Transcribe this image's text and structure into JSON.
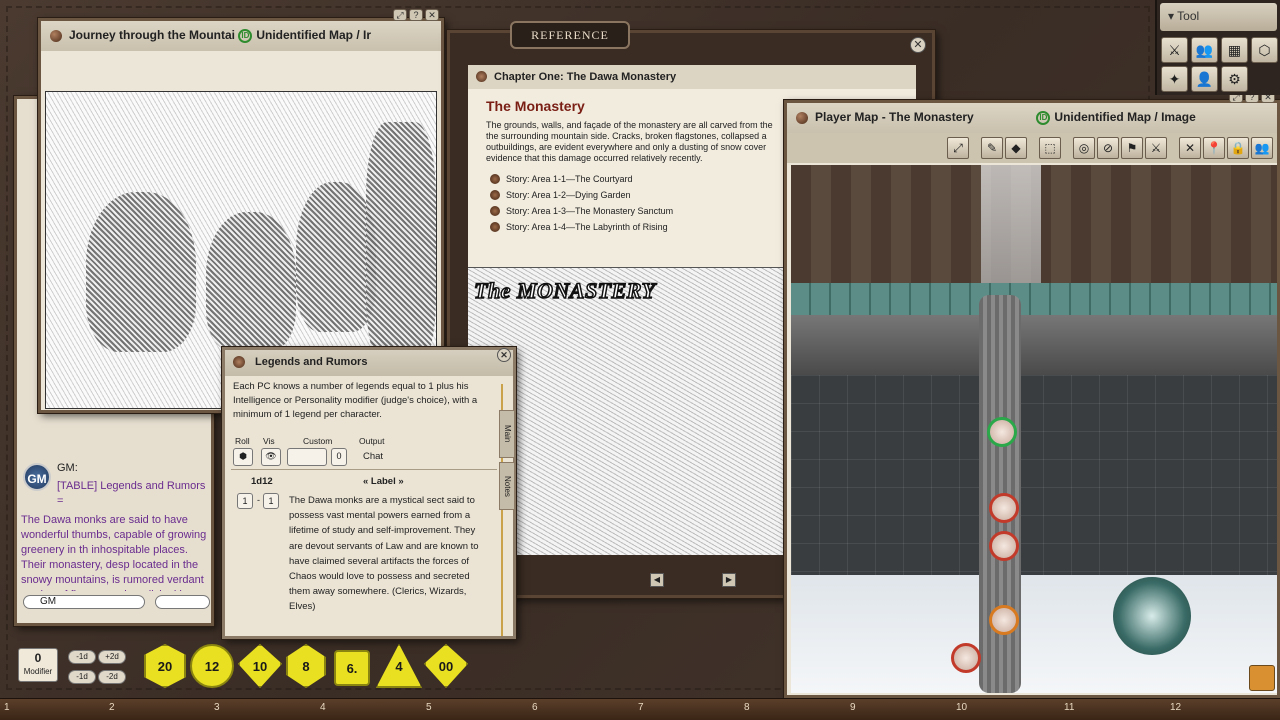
{
  "tool_panel": {
    "title": "Tool",
    "icons": [
      "swords-icon",
      "party-icon",
      "calendar-icon",
      "dice-icon",
      "effects-icon",
      "people-icon",
      "gear-icon"
    ]
  },
  "journey_window": {
    "title": "Journey through the Mountai",
    "id_badge": "ID",
    "subtitle": "Unidentified Map / Ir"
  },
  "chat": {
    "speaker": "GM:",
    "avatar": "GM",
    "table_line": "[TABLE] Legends and Rumors =",
    "message": "The Dawa monks are said to have wonderful thumbs, capable of growing greenery in th inhospitable places. Their monastery, desp located in the snowy mountains, is rumored verdant garden of flowers and medicinal h Warriors, Elves, Clerics)",
    "dropdown_value": "GM"
  },
  "reference": {
    "tab_label": "REFERENCE",
    "header": "Chapter One: The Dawa Monastery",
    "title": "The Monastery",
    "body": "The grounds, walls, and façade of the monastery are all carved from the the surrounding mountain side. Cracks, broken flagstones, collapsed a outbuildings, are evident everywhere and only a dusting of snow cover evidence that this damage occurred relatively recently.",
    "story_links": [
      "Story: Area 1-1—The Courtyard",
      "Story: Area 1-2—Dying Garden",
      "Story: Area 1-3—The Monastery Sanctum",
      "Story: Area 1-4—The Labyrinth of Rising"
    ],
    "art_title": "The MONASTERY"
  },
  "player_map": {
    "title": "Player Map - The Monastery",
    "id_badge": "ID",
    "subtitle": "Unidentified Map / Image"
  },
  "legends": {
    "title": "Legends and Rumors",
    "description": "Each PC knows a number of legends equal to 1 plus his Intelligence or Personality modifier (judge's choice), with a minimum of 1 legend per character.",
    "col_roll": "Roll",
    "col_vis": "Vis",
    "col_custom": "Custom",
    "col_output": "Output",
    "custom_value": "0",
    "output_value": "Chat",
    "dice": "1d12",
    "label_header": "« Label »",
    "range_from": "1",
    "range_sep": "-",
    "range_to": "1",
    "entry_text": "The Dawa monks are a mystical sect said to possess vast mental powers earned from a lifetime of study and self-improvement. They are devout servants of Law and are known to have claimed several artifacts the forces of Chaos would love to possess and secreted them away somewhere. (Clerics, Wizards, Elves)",
    "tab_main": "Main",
    "tab_notes": "Notes"
  },
  "dice_tray": {
    "modifier_value": "0",
    "modifier_label": "Modifier",
    "mods": [
      "-1d",
      "+2d",
      "-1d",
      "-2d"
    ],
    "dice": [
      "20",
      "12",
      "10",
      "8",
      "6.",
      "4",
      "00"
    ]
  },
  "ruler_numbers": [
    "1",
    "2",
    "3",
    "4",
    "5",
    "6",
    "7",
    "8",
    "9",
    "10",
    "11",
    "12"
  ]
}
